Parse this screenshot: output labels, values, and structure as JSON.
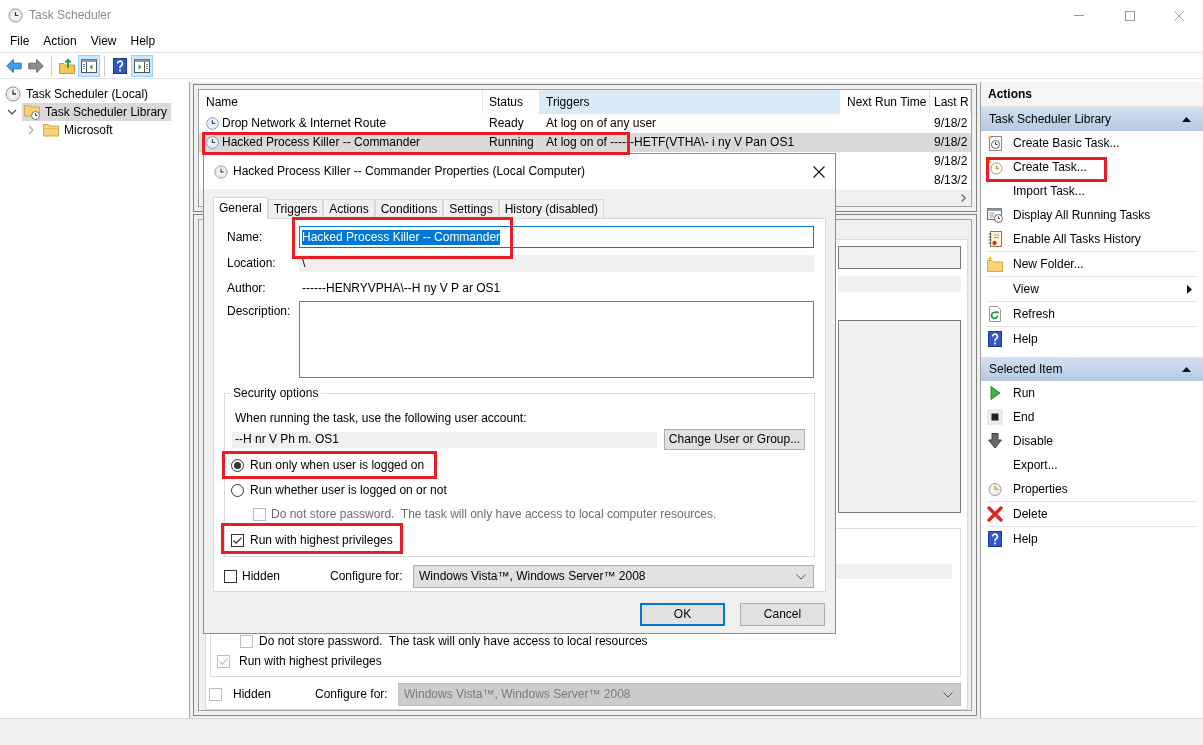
{
  "window": {
    "title": "Task Scheduler",
    "active": false
  },
  "menu": [
    "File",
    "Action",
    "View",
    "Help"
  ],
  "toolbar": [
    [
      {
        "pressed": false
      },
      {
        "pressed": false
      }
    ],
    [
      {
        "pressed": false
      },
      {
        "pressed": true
      }
    ],
    [
      {
        "pressed": false
      },
      {
        "pressed": true
      }
    ]
  ],
  "tree": [
    {
      "label": "Task Scheduler (Local)",
      "selected": false,
      "children": [
        {
          "label": "Task Scheduler Library",
          "selected": true,
          "expanded": true,
          "children": [
            {
              "label": "Microsoft",
              "selected": false,
              "expanded": false
            }
          ]
        }
      ]
    }
  ],
  "task_list": {
    "columns": [
      {
        "label": "Name",
        "selected": false
      },
      {
        "label": "Status",
        "selected": false
      },
      {
        "label": "Triggers",
        "selected": true
      },
      {
        "label": "Next Run Time",
        "selected": false
      },
      {
        "label": "Last R",
        "selected": false
      }
    ],
    "rows": [
      {
        "name": "Drop Network & Internet Route",
        "status": "Ready",
        "triggers": "At log on of any user",
        "column_5": "9/18/2",
        "selected": false,
        "annotated": false
      },
      {
        "name": "Hacked Process Killer -- Commander",
        "status": "Running",
        "triggers": "At log on of ------HETF(VTHA\\- i ny V Pan OS1",
        "column_5": "9/18/2",
        "selected": true,
        "annotated": true
      },
      {
        "column_5": "9/18/2",
        "selected": false,
        "annotated": false
      },
      {
        "column_5": "8/13/2",
        "selected": false,
        "annotated": false
      }
    ]
  },
  "details_pane": {
    "security": {
      "password_option": {
        "label": "Do not store password.  The task will only have access to local resources",
        "checked": false,
        "disabled": true
      },
      "privileges": {
        "label": "Run with highest privileges",
        "checked": true,
        "disabled": true
      }
    },
    "hidden": {
      "label": "Hidden",
      "checked": false,
      "disabled": true
    },
    "configure": {
      "label": "Configure for:",
      "value": "Windows Vista™, Windows Server™ 2008",
      "disabled": true
    }
  },
  "dialog": {
    "title": "Hacked Process Killer -- Commander Properties (Local Computer)",
    "tabs": [
      {
        "label": "General",
        "selected": true
      },
      {
        "label": "Triggers",
        "selected": false
      },
      {
        "label": "Actions",
        "selected": false
      },
      {
        "label": "Conditions",
        "selected": false
      },
      {
        "label": "Settings",
        "selected": false
      },
      {
        "label": "History (disabled)",
        "selected": false
      }
    ],
    "general": {
      "name": {
        "label": "Name:",
        "value": "Hacked Process Killer -- Commander",
        "focused": true,
        "text_selected": true,
        "annotated": true
      },
      "location": {
        "label": "Location:",
        "value": "\\"
      },
      "author": {
        "label": "Author:",
        "value": "------HENRYVPHA\\--H ny V P ar OS1"
      },
      "description": {
        "label": "Description:"
      },
      "security": {
        "title": "Security options",
        "prompt": "When running the task, use the following user account:",
        "account": "--H nr V Ph m. OS1",
        "change_button": "Change User or Group...",
        "run_options": [
          {
            "label": "Run only when user is logged on",
            "selected": true,
            "annotated": true
          },
          {
            "label": "Run whether user is logged on or not",
            "selected": false,
            "annotated": false
          }
        ],
        "password_option": {
          "label": "Do not store password.  The task will only have access to local computer resources.",
          "checked": false,
          "disabled": true
        },
        "privileges": {
          "label": "Run with highest privileges",
          "checked": true,
          "annotated": true
        }
      },
      "hidden": {
        "label": "Hidden",
        "checked": false
      },
      "configure": {
        "label": "Configure for:",
        "value": "Windows Vista™, Windows Server™ 2008"
      }
    },
    "buttons": [
      {
        "label": "OK",
        "default": true
      },
      {
        "label": "Cancel",
        "default": false
      }
    ]
  },
  "actions_panel": {
    "title": "Actions",
    "sections": [
      {
        "title": "Task Scheduler Library",
        "expanded": true,
        "groups": [
          [
            {
              "label": "Create Basic Task...",
              "kind": "command",
              "annotated": false
            },
            {
              "label": "Create Task...",
              "kind": "command",
              "annotated": true
            },
            {
              "label": "Import Task...",
              "kind": "command",
              "annotated": false
            },
            {
              "label": "Display All Running Tasks",
              "kind": "command",
              "annotated": false
            },
            {
              "label": "Enable All Tasks History",
              "kind": "command",
              "annotated": false
            }
          ],
          [
            {
              "label": "New Folder...",
              "kind": "command",
              "annotated": false
            }
          ],
          [
            {
              "label": "View",
              "kind": "submenu",
              "annotated": false
            }
          ],
          [
            {
              "label": "Refresh",
              "kind": "command",
              "annotated": false
            }
          ],
          [
            {
              "label": "Help",
              "kind": "command",
              "annotated": false
            }
          ]
        ]
      },
      {
        "title": "Selected Item",
        "expanded": true,
        "groups": [
          [
            {
              "label": "Run",
              "kind": "command",
              "annotated": false
            },
            {
              "label": "End",
              "kind": "command",
              "annotated": false
            },
            {
              "label": "Disable",
              "kind": "command",
              "annotated": false
            },
            {
              "label": "Export...",
              "kind": "command",
              "annotated": false
            },
            {
              "label": "Properties",
              "kind": "command",
              "annotated": false
            }
          ],
          [
            {
              "label": "Delete",
              "kind": "command",
              "annotated": false
            }
          ],
          [
            {
              "label": "Help",
              "kind": "command",
              "annotated": false
            }
          ]
        ]
      }
    ]
  }
}
